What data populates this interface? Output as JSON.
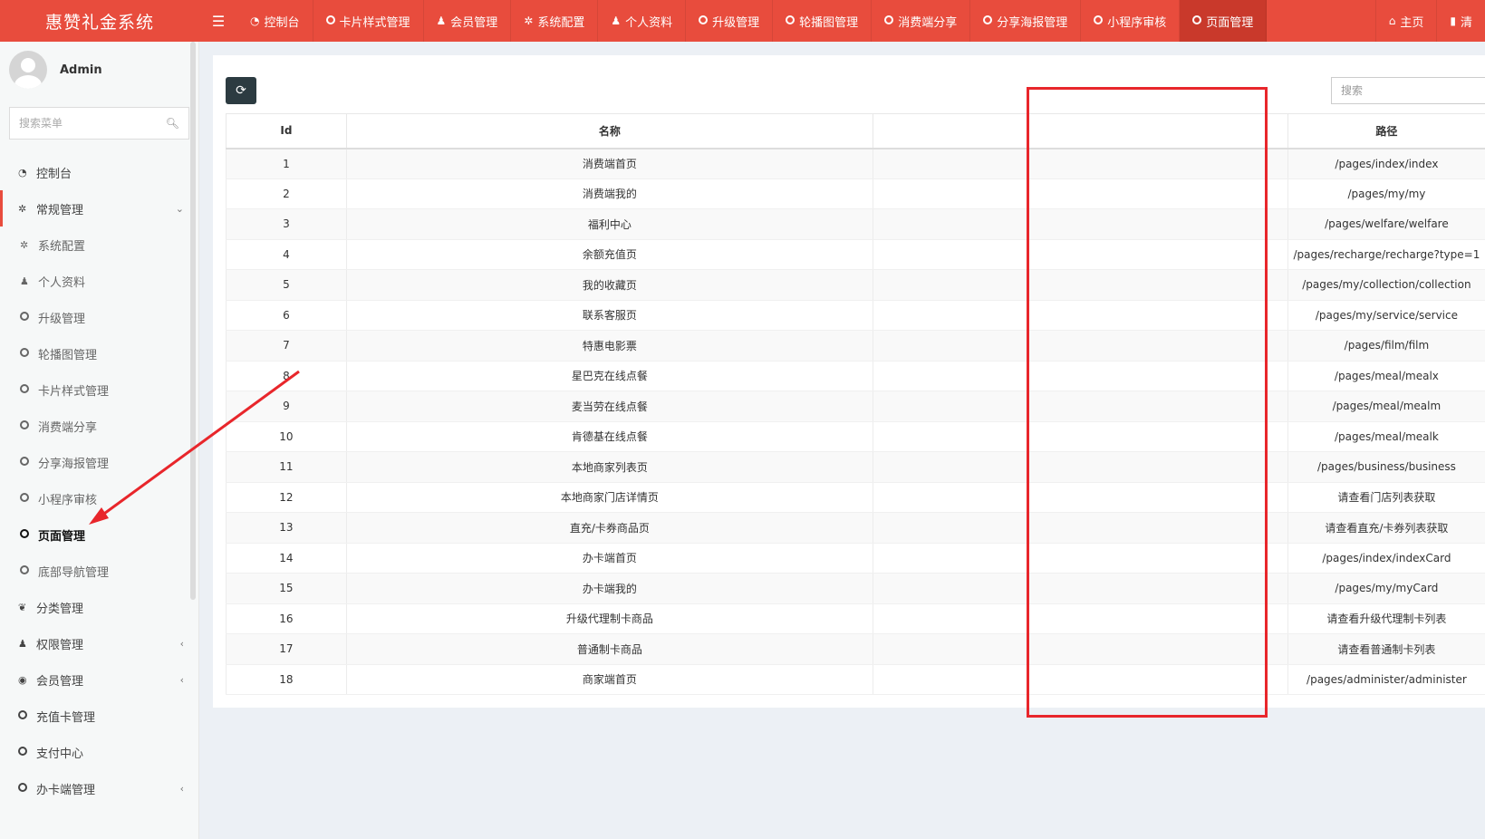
{
  "app": {
    "title": "惠赞礼金系统"
  },
  "header": {
    "nav": [
      {
        "label": "控制台",
        "icon": "dashboard-icon",
        "active": false
      },
      {
        "label": "卡片样式管理",
        "icon": "circle-icon",
        "active": false
      },
      {
        "label": "会员管理",
        "icon": "user-icon",
        "active": false
      },
      {
        "label": "系统配置",
        "icon": "gear-icon",
        "active": false
      },
      {
        "label": "个人资料",
        "icon": "user-icon",
        "active": false
      },
      {
        "label": "升级管理",
        "icon": "circle-icon",
        "active": false
      },
      {
        "label": "轮播图管理",
        "icon": "circle-icon",
        "active": false
      },
      {
        "label": "消费端分享",
        "icon": "circle-icon",
        "active": false
      },
      {
        "label": "分享海报管理",
        "icon": "circle-icon",
        "active": false
      },
      {
        "label": "小程序审核",
        "icon": "circle-icon",
        "active": false
      },
      {
        "label": "页面管理",
        "icon": "circle-icon",
        "active": true
      }
    ],
    "right": [
      {
        "label": "主页",
        "icon": "home-icon"
      },
      {
        "label": "清",
        "icon": "trash-icon"
      }
    ]
  },
  "sidebar": {
    "user": {
      "name": "Admin"
    },
    "search_placeholder": "搜索菜单",
    "items": [
      {
        "label": "控制台",
        "icon": "dashboard-icon",
        "type": "top"
      },
      {
        "label": "常规管理",
        "icon": "cogs-icon",
        "type": "open",
        "arrow": "⌄"
      },
      {
        "label": "系统配置",
        "icon": "gear-icon",
        "type": "sub"
      },
      {
        "label": "个人资料",
        "icon": "user-icon",
        "type": "sub"
      },
      {
        "label": "升级管理",
        "icon": "circle-icon",
        "type": "sub"
      },
      {
        "label": "轮播图管理",
        "icon": "circle-icon",
        "type": "sub"
      },
      {
        "label": "卡片样式管理",
        "icon": "circle-icon",
        "type": "sub"
      },
      {
        "label": "消费端分享",
        "icon": "circle-icon",
        "type": "sub"
      },
      {
        "label": "分享海报管理",
        "icon": "circle-icon",
        "type": "sub"
      },
      {
        "label": "小程序审核",
        "icon": "circle-icon",
        "type": "sub"
      },
      {
        "label": "页面管理",
        "icon": "circle-icon",
        "type": "current"
      },
      {
        "label": "底部导航管理",
        "icon": "circle-icon",
        "type": "sub"
      },
      {
        "label": "分类管理",
        "icon": "leaf-icon",
        "type": "top"
      },
      {
        "label": "权限管理",
        "icon": "group-icon",
        "type": "top",
        "arrow": "‹"
      },
      {
        "label": "会员管理",
        "icon": "user-circle-icon",
        "type": "top",
        "arrow": "‹"
      },
      {
        "label": "充值卡管理",
        "icon": "circle-icon",
        "type": "top"
      },
      {
        "label": "支付中心",
        "icon": "circle-icon",
        "type": "top"
      },
      {
        "label": "办卡端管理",
        "icon": "circle-icon",
        "type": "top",
        "arrow": "‹"
      }
    ]
  },
  "toolbar": {
    "search_placeholder": "搜索"
  },
  "table": {
    "headers": {
      "id": "Id",
      "name": "名称",
      "path": "路径"
    },
    "rows": [
      {
        "id": "1",
        "name": "消费端首页",
        "path": "/pages/index/index"
      },
      {
        "id": "2",
        "name": "消费端我的",
        "path": "/pages/my/my"
      },
      {
        "id": "3",
        "name": "福利中心",
        "path": "/pages/welfare/welfare"
      },
      {
        "id": "4",
        "name": "余额充值页",
        "path": "/pages/recharge/recharge?type=1"
      },
      {
        "id": "5",
        "name": "我的收藏页",
        "path": "/pages/my/collection/collection"
      },
      {
        "id": "6",
        "name": "联系客服页",
        "path": "/pages/my/service/service"
      },
      {
        "id": "7",
        "name": "特惠电影票",
        "path": "/pages/film/film"
      },
      {
        "id": "8",
        "name": "星巴克在线点餐",
        "path": "/pages/meal/mealx"
      },
      {
        "id": "9",
        "name": "麦当劳在线点餐",
        "path": "/pages/meal/mealm"
      },
      {
        "id": "10",
        "name": "肯德基在线点餐",
        "path": "/pages/meal/mealk"
      },
      {
        "id": "11",
        "name": "本地商家列表页",
        "path": "/pages/business/business"
      },
      {
        "id": "12",
        "name": "本地商家门店详情页",
        "path": "请查看门店列表获取"
      },
      {
        "id": "13",
        "name": "直充/卡券商品页",
        "path": "请查看直充/卡券列表获取"
      },
      {
        "id": "14",
        "name": "办卡端首页",
        "path": "/pages/index/indexCard"
      },
      {
        "id": "15",
        "name": "办卡端我的",
        "path": "/pages/my/myCard"
      },
      {
        "id": "16",
        "name": "升级代理制卡商品",
        "path": "请查看升级代理制卡列表"
      },
      {
        "id": "17",
        "name": "普通制卡商品",
        "path": "请查看普通制卡列表"
      },
      {
        "id": "18",
        "name": "商家端首页",
        "path": "/pages/administer/administer"
      }
    ]
  },
  "colors": {
    "header": "#e84c3d",
    "annotation": "#e8262b",
    "button": "#2c3b41"
  }
}
